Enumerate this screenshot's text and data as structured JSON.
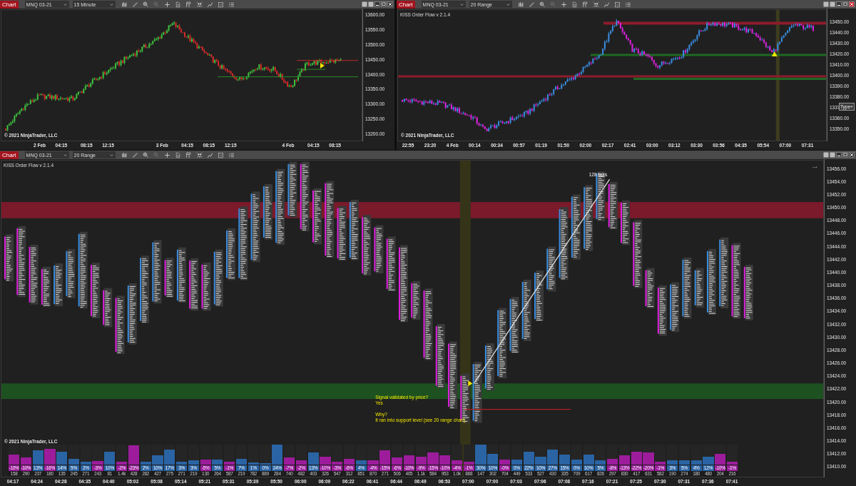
{
  "panels": [
    {
      "toolbar": {
        "label": "Chart",
        "instrument": "MNQ 03-21",
        "interval": "15 Minute",
        "close_highlighted": false
      },
      "kind": "candles",
      "price_axis": [
        "13600.00",
        "13550.00",
        "13500.00",
        "13450.00",
        "13400.00",
        "13350.00",
        "13300.00",
        "13250.00",
        "13200.00"
      ],
      "time_axis": [
        "2 Feb",
        "04:15",
        "08:15",
        "12:15",
        "3 Feb",
        "04:15",
        "08:15",
        "12:15",
        "4 Feb",
        "04:15",
        "08:15"
      ],
      "copyright": "© 2021 NinjaTrader, LLC"
    },
    {
      "toolbar": {
        "label": "Chart",
        "instrument": "MNQ 03-21",
        "interval": "20 Range",
        "close_highlighted": true
      },
      "kind": "range-bars",
      "indicator": "KISS Order Flow v 2.1.4",
      "price_axis": [
        "13450.00",
        "13440.00",
        "13430.00",
        "13420.00",
        "13410.00",
        "13400.00",
        "13390.00",
        "13380.00",
        "1337",
        "13360.00",
        "13350.00"
      ],
      "tooltip": "Type+",
      "time_axis": [
        "22:55",
        "23:20",
        "4 Feb",
        "00:14",
        "00:34",
        "00:57",
        "01:19",
        "01:50",
        "02:00",
        "02:17",
        "02:41",
        "03:00",
        "03:12",
        "03:30",
        "03:56",
        "04:35",
        "05:54",
        "07:00",
        "07:31"
      ],
      "copyright": "© 2021 NinjaTrader, LLC"
    },
    {
      "toolbar": {
        "label": "Chart",
        "instrument": "MNQ 03-21",
        "interval": "20 Range",
        "close_highlighted": false
      },
      "kind": "footprint",
      "indicator": "KISS Order Flow v 2.1.4",
      "arrow": "→",
      "ticks_label": "128 ticks",
      "annotation": [
        "Signal validated by price?",
        "Yes",
        "Why?",
        "It ran into support level (see 20 range chart)"
      ],
      "price_axis": [
        "13456.00",
        "13454.00",
        "13452.00",
        "13450.00",
        "13448.00",
        "13446.00",
        "13444.00",
        "13442.00",
        "13440.00",
        "13438.00",
        "13436.00",
        "13434.00",
        "13432.00",
        "13430.00",
        "13428.00",
        "13426.00",
        "13424.00",
        "13422.00",
        "13420.00",
        "13418.00",
        "13416.00",
        "13414.00",
        "13412.00",
        "13410.00"
      ],
      "time_axis": [
        "04:17",
        "04:24",
        "04:28",
        "04:35",
        "04:40",
        "05:02",
        "05:08",
        "05:14",
        "05:21",
        "05:31",
        "05:39",
        "05:50",
        "06:00",
        "06:09",
        "06:22",
        "06:41",
        "06:44",
        "06:49",
        "06:53",
        "07:00",
        "07:00",
        "07:03",
        "07:06",
        "07:08",
        "07:16",
        "07:21",
        "07:25",
        "07:30",
        "07:31",
        "07:36",
        "07:41"
      ],
      "copyright": "© 2021 NinjaTrader, LLC",
      "volume_bars": [
        {
          "pct": "-10%",
          "vol": "158",
          "color": "#9c1c9c",
          "level": 0.5
        },
        {
          "pct": "-10%",
          "vol": "290",
          "color": "#9c1c9c",
          "level": 0.35
        },
        {
          "pct": "13%",
          "vol": "237",
          "color": "#2a64a4",
          "level": 0.7
        },
        {
          "pct": "-16%",
          "vol": "180",
          "color": "#9c1c9c",
          "level": 0.8
        },
        {
          "pct": "14%",
          "vol": "135",
          "color": "#2a64a4",
          "level": 0.65
        },
        {
          "pct": "5%",
          "vol": "245",
          "color": "#2a64a4",
          "level": 0.3
        },
        {
          "pct": "2%",
          "vol": "271",
          "color": "#2a64a4",
          "level": 0.15
        },
        {
          "pct": "-3%",
          "vol": "243",
          "color": "#9c1c9c",
          "level": 0.18
        },
        {
          "pct": "10%",
          "vol": "81",
          "color": "#2a64a4",
          "level": 0.65
        },
        {
          "pct": "-2%",
          "vol": "1.4k",
          "color": "#9c1c9c",
          "level": 0.15
        },
        {
          "pct": "-23%",
          "vol": "428",
          "color": "#9c1c9c",
          "level": 0.95
        },
        {
          "pct": "2%",
          "vol": "282",
          "color": "#2a64a4",
          "level": 0.15
        },
        {
          "pct": "10%",
          "vol": "427",
          "color": "#2a64a4",
          "level": 0.45
        },
        {
          "pct": "17%",
          "vol": "275",
          "color": "#2a64a4",
          "level": 0.75
        },
        {
          "pct": "3%",
          "vol": "271",
          "color": "#2a64a4",
          "level": 0.15
        },
        {
          "pct": "3%",
          "vol": "219",
          "color": "#2a64a4",
          "level": 0.2
        },
        {
          "pct": "-5%",
          "vol": "130",
          "color": "#9c1c9c",
          "level": 0.25
        },
        {
          "pct": "5%",
          "vol": "264",
          "color": "#2a64a4",
          "level": 0.25
        },
        {
          "pct": "-1%",
          "vol": "587",
          "color": "#9c1c9c",
          "level": 0.15
        },
        {
          "pct": "7%",
          "vol": "219",
          "color": "#2a64a4",
          "level": 0.3
        },
        {
          "pct": "1%",
          "vol": "782",
          "color": "#2a64a4",
          "level": 0.12
        },
        {
          "pct": "0%",
          "vol": "889",
          "color": "#2a64a4",
          "level": 0.08
        },
        {
          "pct": "24%",
          "vol": "284",
          "color": "#2a64a4",
          "level": 1.0
        },
        {
          "pct": "-7%",
          "vol": "740",
          "color": "#9c1c9c",
          "level": 0.35
        },
        {
          "pct": "-2%",
          "vol": "482",
          "color": "#9c1c9c",
          "level": 0.2
        },
        {
          "pct": "13%",
          "vol": "403",
          "color": "#2a64a4",
          "level": 0.6
        },
        {
          "pct": "-10%",
          "vol": "326",
          "color": "#9c1c9c",
          "level": 0.4
        },
        {
          "pct": "-3%",
          "vol": "547",
          "color": "#9c1c9c",
          "level": 0.15
        },
        {
          "pct": "-6%",
          "vol": "312",
          "color": "#9c1c9c",
          "level": 0.3
        },
        {
          "pct": "4%",
          "vol": "851",
          "color": "#2a64a4",
          "level": 0.2
        },
        {
          "pct": "-4%",
          "vol": "870",
          "color": "#9c1c9c",
          "level": 0.2
        },
        {
          "pct": "-15%",
          "vol": "271",
          "color": "#9c1c9c",
          "level": 0.7
        },
        {
          "pct": "-6%",
          "vol": "506",
          "color": "#9c1c9c",
          "level": 0.35
        },
        {
          "pct": "-10%",
          "vol": "405",
          "color": "#9c1c9c",
          "level": 0.45
        },
        {
          "pct": "-9%",
          "vol": "1.1k",
          "color": "#9c1c9c",
          "level": 0.4
        },
        {
          "pct": "-15%",
          "vol": "584",
          "color": "#9c1c9c",
          "level": 0.6
        },
        {
          "pct": "-10%",
          "vol": "953",
          "color": "#9c1c9c",
          "level": 0.45
        },
        {
          "pct": "-4%",
          "vol": "1.0k",
          "color": "#9c1c9c",
          "level": 0.2
        },
        {
          "pct": "-1%",
          "vol": "888",
          "color": "#9c1c9c",
          "level": 0.15
        },
        {
          "pct": "30%",
          "vol": "147",
          "color": "#2a64a4",
          "level": 1.0
        },
        {
          "pct": "10%",
          "vol": "302",
          "color": "#2a64a4",
          "level": 0.55
        },
        {
          "pct": "-0%",
          "vol": "704",
          "color": "#9c1c9c",
          "level": 0.25
        },
        {
          "pct": "0%",
          "vol": "449",
          "color": "#2a64a4",
          "level": 0.25
        },
        {
          "pct": "22%",
          "vol": "533",
          "color": "#2a64a4",
          "level": 0.65
        },
        {
          "pct": "10%",
          "vol": "527",
          "color": "#2a64a4",
          "level": 0.4
        },
        {
          "pct": "27%",
          "vol": "430",
          "color": "#2a64a4",
          "level": 0.75
        },
        {
          "pct": "15%",
          "vol": "335",
          "color": "#2a64a4",
          "level": 0.5
        },
        {
          "pct": "0%",
          "vol": "709",
          "color": "#2a64a4",
          "level": 0.25
        },
        {
          "pct": "10%",
          "vol": "617",
          "color": "#2a64a4",
          "level": 0.5
        },
        {
          "pct": "5%",
          "vol": "826",
          "color": "#2a64a4",
          "level": 0.2
        },
        {
          "pct": "-8%",
          "vol": "297",
          "color": "#9c1c9c",
          "level": 0.3
        },
        {
          "pct": "-13%",
          "vol": "830",
          "color": "#9c1c9c",
          "level": 0.45
        },
        {
          "pct": "-22%",
          "vol": "417",
          "color": "#9c1c9c",
          "level": 0.65
        },
        {
          "pct": "-20%",
          "vol": "631",
          "color": "#9c1c9c",
          "level": 0.6
        },
        {
          "pct": "-1%",
          "vol": "582",
          "color": "#9c1c9c",
          "level": 0.15
        },
        {
          "pct": "3%",
          "vol": "190",
          "color": "#2a64a4",
          "level": 0.2
        },
        {
          "pct": "5%",
          "vol": "274",
          "color": "#2a64a4",
          "level": 0.22
        },
        {
          "pct": "4%",
          "vol": "180",
          "color": "#2a64a4",
          "level": 0.2
        },
        {
          "pct": "12%",
          "vol": "480",
          "color": "#2a64a4",
          "level": 0.4
        },
        {
          "pct": "-10%",
          "vol": "204",
          "color": "#9c1c9c",
          "level": 0.55
        },
        {
          "pct": "-1%",
          "vol": "216",
          "color": "#9c1c9c",
          "level": 0.15
        }
      ]
    }
  ]
}
